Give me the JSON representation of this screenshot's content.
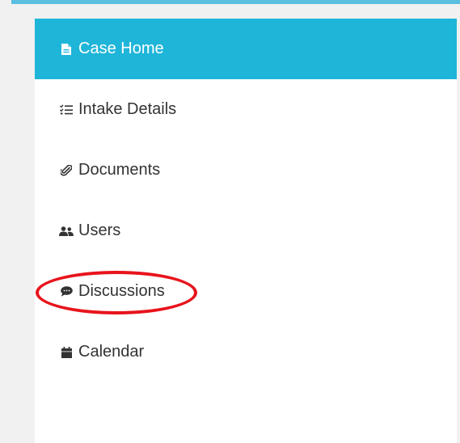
{
  "nav": {
    "items": [
      {
        "label": "Case Home",
        "icon": "document-icon",
        "active": true
      },
      {
        "label": "Intake Details",
        "icon": "checklist-icon",
        "active": false
      },
      {
        "label": "Documents",
        "icon": "paperclip-icon",
        "active": false
      },
      {
        "label": "Users",
        "icon": "users-icon",
        "active": false
      },
      {
        "label": "Discussions",
        "icon": "chat-bubble-icon",
        "active": false
      },
      {
        "label": "Calendar",
        "icon": "calendar-icon",
        "active": false
      }
    ]
  },
  "colors": {
    "active_bg": "#1fb5d9",
    "top_line": "#5bbfe0",
    "annotation": "#e8141c",
    "text": "#333333"
  }
}
